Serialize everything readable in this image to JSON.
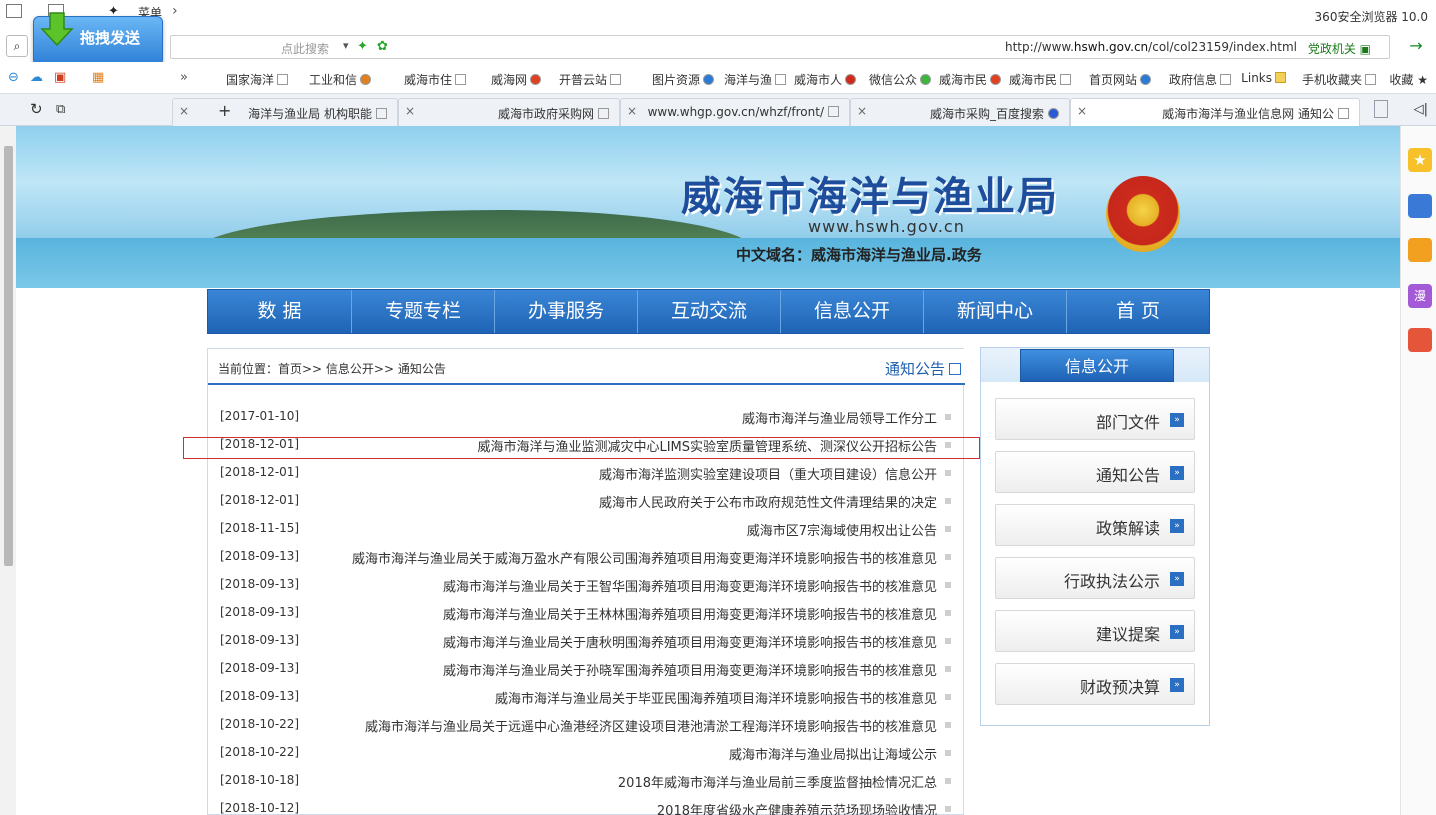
{
  "browser": {
    "title": "360安全浏览器 10.0",
    "menu_label": "菜单",
    "url_prefix": "http://www.",
    "url_domain": "hswh.gov.cn",
    "url_path": "/col/col23159/index.html",
    "gov_badge": "党政机关",
    "search_placeholder": "点此搜索"
  },
  "floating_widget": {
    "label": "拖拽发送"
  },
  "bookmarks": [
    {
      "label": "收藏"
    },
    {
      "label": "手机收藏夹"
    },
    {
      "label": "Links"
    },
    {
      "label": "政府信息"
    },
    {
      "label": "首页网站"
    },
    {
      "label": "威海市民"
    },
    {
      "label": "威海市民"
    },
    {
      "label": "微信公众"
    },
    {
      "label": "威海市人"
    },
    {
      "label": "海洋与渔"
    },
    {
      "label": "图片资源"
    },
    {
      "label": "开普云站"
    },
    {
      "label": "威海网"
    },
    {
      "label": "威海市住"
    },
    {
      "label": "工业和信"
    },
    {
      "label": "国家海洋"
    }
  ],
  "tabs": [
    {
      "label": "威海市海洋与渔业信息网 通知公",
      "active": true
    },
    {
      "label": "威海市采购_百度搜索"
    },
    {
      "label": "www.whgp.gov.cn/whzf/front/"
    },
    {
      "label": "威海市政府采购网"
    },
    {
      "label": "海洋与渔业局 机构职能"
    }
  ],
  "site": {
    "title": "威海市海洋与渔业局",
    "domain": "www.hswh.gov.cn",
    "cn_domain": "中文域名：威海市海洋与渔业局.政务"
  },
  "nav": [
    {
      "label": "首 页"
    },
    {
      "label": "新闻中心"
    },
    {
      "label": "信息公开"
    },
    {
      "label": "互动交流"
    },
    {
      "label": "办事服务"
    },
    {
      "label": "专题专栏"
    },
    {
      "label": "数 据"
    }
  ],
  "content": {
    "location": "当前位置：首页>> 信息公开>> 通知公告",
    "section_title": "通知公告",
    "items": [
      {
        "text": "威海市海洋与渔业局领导工作分工",
        "date": "[2017-01-10]"
      },
      {
        "text": "威海市海洋与渔业监测减灾中心LIMS实验室质量管理系统、测深仪公开招标公告",
        "date": "[2018-12-01]"
      },
      {
        "text": "威海市海洋监测实验室建设项目（重大项目建设）信息公开",
        "date": "[2018-12-01]"
      },
      {
        "text": "威海市人民政府关于公布市政府规范性文件清理结果的决定",
        "date": "[2018-12-01]"
      },
      {
        "text": "威海市区7宗海域使用权出让公告",
        "date": "[2018-11-15]"
      },
      {
        "text": "威海市海洋与渔业局关于威海万盈水产有限公司围海养殖项目用海变更海洋环境影响报告书的核准意见",
        "date": "[2018-09-13]"
      },
      {
        "text": "威海市海洋与渔业局关于王智华围海养殖项目用海变更海洋环境影响报告书的核准意见",
        "date": "[2018-09-13]"
      },
      {
        "text": "威海市海洋与渔业局关于王林林围海养殖项目用海变更海洋环境影响报告书的核准意见",
        "date": "[2018-09-13]"
      },
      {
        "text": "威海市海洋与渔业局关于唐秋明围海养殖项目用海变更海洋环境影响报告书的核准意见",
        "date": "[2018-09-13]"
      },
      {
        "text": "威海市海洋与渔业局关于孙晓军围海养殖项目用海变更海洋环境影响报告书的核准意见",
        "date": "[2018-09-13]"
      },
      {
        "text": "威海市海洋与渔业局关于毕亚民围海养殖项目海洋环境影响报告书的核准意见",
        "date": "[2018-09-13]"
      },
      {
        "text": "威海市海洋与渔业局关于远遥中心渔港经济区建设项目港池清淤工程海洋环境影响报告书的核准意见",
        "date": "[2018-10-22]"
      },
      {
        "text": "威海市海洋与渔业局拟出让海域公示",
        "date": "[2018-10-22]"
      },
      {
        "text": "2018年威海市海洋与渔业局前三季度监督抽检情况汇总",
        "date": "[2018-10-18]"
      },
      {
        "text": "2018年度省级水产健康养殖示范场现场验收情况",
        "date": "[2018-10-12]"
      }
    ]
  },
  "sidebar": {
    "header": "信息公开",
    "items": [
      {
        "label": "部门文件"
      },
      {
        "label": "通知公告"
      },
      {
        "label": "政策解读"
      },
      {
        "label": "行政执法公示"
      },
      {
        "label": "建议提案"
      },
      {
        "label": "财政预决算"
      }
    ]
  },
  "colors": {
    "accent": "#1f63b4",
    "nav_bg": "#2a75c8",
    "highlight": "#d03030"
  }
}
